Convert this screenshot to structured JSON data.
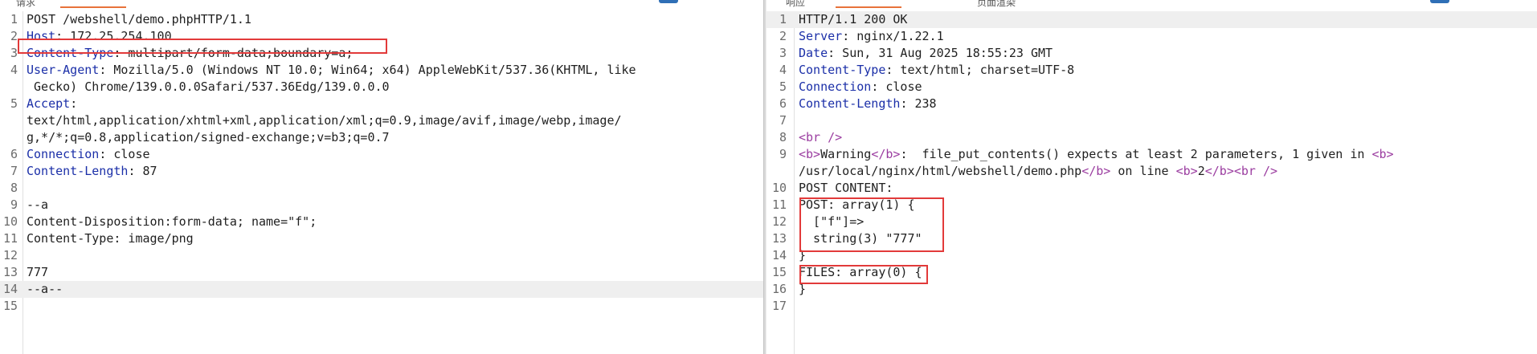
{
  "colors": {
    "accent": "#e8723a",
    "annotation": "#e23a3a",
    "header_name": "#1b2fa8",
    "html_tag": "#9b3da0",
    "line_highlight": "#efefef"
  },
  "request": {
    "tab_label": "请求",
    "icon": "layout-toggle-icon",
    "lines": [
      {
        "n": "1",
        "segs": [
          {
            "t": "POST /webshell/demo.phpHTTP/1.1"
          }
        ]
      },
      {
        "n": "2",
        "segs": [
          {
            "t": "Host",
            "k": 1
          },
          {
            "t": ": 172.25.254.100"
          }
        ]
      },
      {
        "n": "3",
        "segs": [
          {
            "t": "Content-Type",
            "k": 1
          },
          {
            "t": ": multipart/form-data;boundary=a;"
          }
        ]
      },
      {
        "n": "4",
        "segs": [
          {
            "t": "User-Agent",
            "k": 1
          },
          {
            "t": ": Mozilla/5.0 (Windows NT 10.0; Win64; x64) AppleWebKit/537.36(KHTML, like"
          }
        ]
      },
      {
        "n": "",
        "segs": [
          {
            "t": " Gecko) Chrome/139.0.0.0Safari/537.36Edg/139.0.0.0"
          }
        ]
      },
      {
        "n": "5",
        "segs": [
          {
            "t": "Accept",
            "k": 1
          },
          {
            "t": ":"
          }
        ]
      },
      {
        "n": "",
        "segs": [
          {
            "t": "text/html,application/xhtml+xml,application/xml;q=0.9,image/avif,image/webp,image/"
          }
        ]
      },
      {
        "n": "",
        "segs": [
          {
            "t": "g,*/*;q=0.8,application/signed-exchange;v=b3;q=0.7"
          }
        ]
      },
      {
        "n": "6",
        "segs": [
          {
            "t": "Connection",
            "k": 1
          },
          {
            "t": ": close"
          }
        ]
      },
      {
        "n": "7",
        "segs": [
          {
            "t": "Content-Length",
            "k": 1
          },
          {
            "t": ": 87"
          }
        ]
      },
      {
        "n": "8",
        "segs": []
      },
      {
        "n": "9",
        "segs": [
          {
            "t": "--a"
          }
        ]
      },
      {
        "n": "10",
        "segs": [
          {
            "t": "Content-Disposition:form-data; name=\"f\";"
          }
        ]
      },
      {
        "n": "11",
        "segs": [
          {
            "t": "Content-Type: image/png"
          }
        ]
      },
      {
        "n": "12",
        "segs": []
      },
      {
        "n": "13",
        "segs": [
          {
            "t": "777"
          }
        ]
      },
      {
        "n": "14",
        "segs": [
          {
            "t": "--a--"
          }
        ],
        "hl": true
      },
      {
        "n": "15",
        "segs": []
      }
    ]
  },
  "response": {
    "tab_label": "响应",
    "tab_label_2": "页面渲染",
    "icon": "layout-toggle-icon",
    "lines": [
      {
        "n": "1",
        "segs": [
          {
            "t": "HTTP/1.1 200 OK"
          }
        ],
        "hl": true
      },
      {
        "n": "2",
        "segs": [
          {
            "t": "Server",
            "k": 1
          },
          {
            "t": ": nginx/1.22.1"
          }
        ]
      },
      {
        "n": "3",
        "segs": [
          {
            "t": "Date",
            "k": 1
          },
          {
            "t": ": Sun, 31 Aug 2025 18:55:23 GMT"
          }
        ]
      },
      {
        "n": "4",
        "segs": [
          {
            "t": "Content-Type",
            "k": 1
          },
          {
            "t": ": text/html; charset=UTF-8"
          }
        ]
      },
      {
        "n": "5",
        "segs": [
          {
            "t": "Connection",
            "k": 1
          },
          {
            "t": ": close"
          }
        ]
      },
      {
        "n": "6",
        "segs": [
          {
            "t": "Content-Length",
            "k": 1
          },
          {
            "t": ": 238"
          }
        ]
      },
      {
        "n": "7",
        "segs": []
      },
      {
        "n": "8",
        "segs": [
          {
            "t": "<br />",
            "tag": 1
          }
        ]
      },
      {
        "n": "9",
        "segs": [
          {
            "t": "<b>",
            "tag": 1
          },
          {
            "t": "Warning"
          },
          {
            "t": "</b>",
            "tag": 1
          },
          {
            "t": ":  file_put_contents() expects at least 2 parameters, 1 given in "
          },
          {
            "t": "<b>",
            "tag": 1
          }
        ]
      },
      {
        "n": "",
        "segs": [
          {
            "t": "/usr/local/nginx/html/webshell/demo.php"
          },
          {
            "t": "</b>",
            "tag": 1
          },
          {
            "t": " on line "
          },
          {
            "t": "<b>",
            "tag": 1
          },
          {
            "t": "2"
          },
          {
            "t": "</b>",
            "tag": 1
          },
          {
            "t": "<br />",
            "tag": 1
          }
        ]
      },
      {
        "n": "10",
        "segs": [
          {
            "t": "POST CONTENT:"
          }
        ]
      },
      {
        "n": "11",
        "segs": [
          {
            "t": "POST: array(1) {"
          }
        ]
      },
      {
        "n": "12",
        "segs": [
          {
            "t": "  [\"f\"]=>"
          }
        ]
      },
      {
        "n": "13",
        "segs": [
          {
            "t": "  string(3) \"777\""
          }
        ]
      },
      {
        "n": "14",
        "segs": [
          {
            "t": "}"
          }
        ]
      },
      {
        "n": "15",
        "segs": [
          {
            "t": "FILES: array(0) {"
          }
        ]
      },
      {
        "n": "16",
        "segs": [
          {
            "t": "}"
          }
        ]
      },
      {
        "n": "17",
        "segs": []
      }
    ]
  }
}
